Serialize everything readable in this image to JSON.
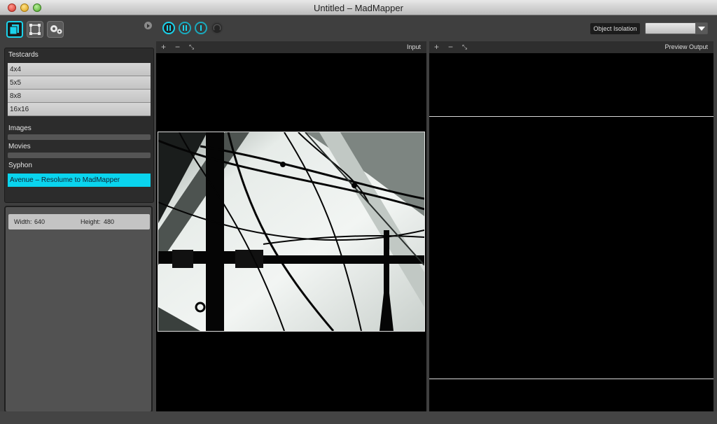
{
  "window": {
    "title": "Untitled – MadMapper"
  },
  "sidebar": {
    "sections": {
      "testcards": {
        "label": "Testcards",
        "items": [
          "4x4",
          "5x5",
          "8x8",
          "16x16"
        ]
      },
      "images": {
        "label": "Images"
      },
      "movies": {
        "label": "Movies"
      },
      "syphon": {
        "label": "Syphon",
        "items": [
          "Avenue – Resolume to MadMapper"
        ]
      }
    },
    "info": {
      "width_label": "Width:",
      "width_value": "640",
      "height_label": "Height:",
      "height_value": "480"
    }
  },
  "toolbar": {
    "object_isolation_label": "Object Isolation",
    "isolation_select_value": ""
  },
  "viewports": {
    "input": {
      "label": "Input",
      "zoom_in": "+",
      "zoom_out": "−",
      "fit": "⤡"
    },
    "output": {
      "label": "Preview Output",
      "zoom_in": "+",
      "zoom_out": "−",
      "fit": "⤡"
    }
  },
  "colors": {
    "accent": "#1ad3ec",
    "selected_source": "#0ad4ee",
    "panel_bg": "#3f3f3f"
  },
  "icons": [
    "sources-icon",
    "surfaces-icon",
    "settings-gears-icon",
    "collapse-arrow-icon",
    "pause-icon",
    "dropdown-arrow-icon"
  ]
}
